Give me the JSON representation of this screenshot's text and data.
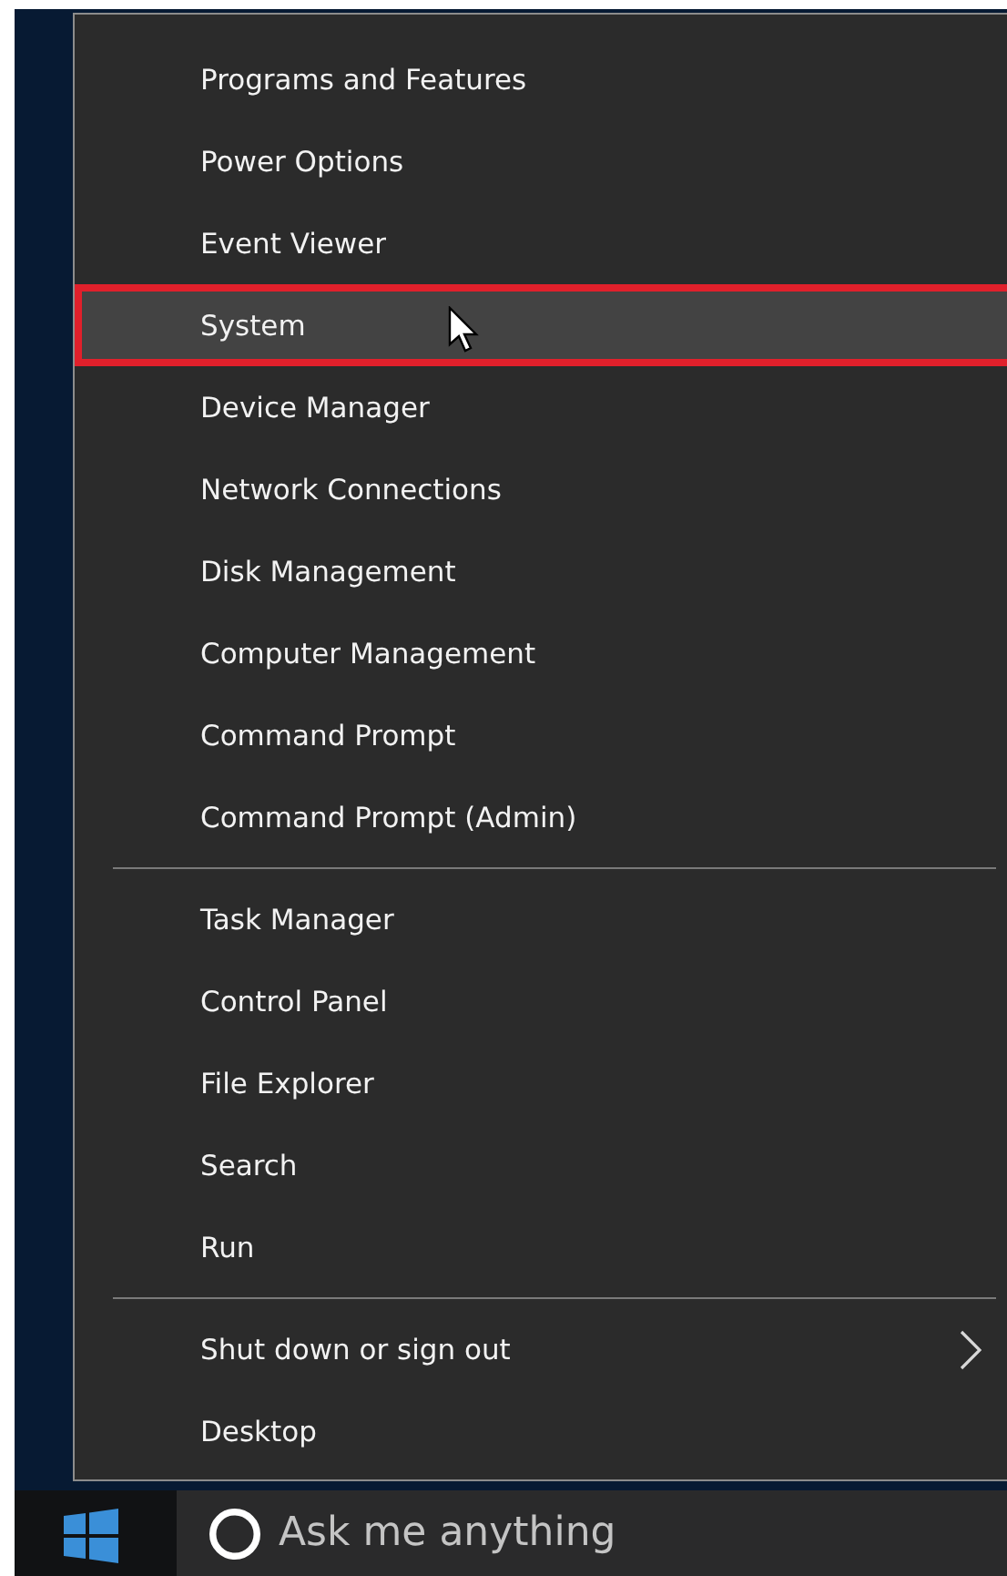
{
  "menu": {
    "groups": [
      {
        "items": [
          {
            "label": "Programs and Features",
            "selected": false,
            "submenu": false
          },
          {
            "label": "Power Options",
            "selected": false,
            "submenu": false
          },
          {
            "label": "Event Viewer",
            "selected": false,
            "submenu": false
          },
          {
            "label": "System",
            "selected": true,
            "submenu": false
          },
          {
            "label": "Device Manager",
            "selected": false,
            "submenu": false
          },
          {
            "label": "Network Connections",
            "selected": false,
            "submenu": false
          },
          {
            "label": "Disk Management",
            "selected": false,
            "submenu": false
          },
          {
            "label": "Computer Management",
            "selected": false,
            "submenu": false
          },
          {
            "label": "Command Prompt",
            "selected": false,
            "submenu": false
          },
          {
            "label": "Command Prompt (Admin)",
            "selected": false,
            "submenu": false
          }
        ]
      },
      {
        "items": [
          {
            "label": "Task Manager",
            "selected": false,
            "submenu": false
          },
          {
            "label": "Control Panel",
            "selected": false,
            "submenu": false
          },
          {
            "label": "File Explorer",
            "selected": false,
            "submenu": false
          },
          {
            "label": "Search",
            "selected": false,
            "submenu": false
          },
          {
            "label": "Run",
            "selected": false,
            "submenu": false
          }
        ]
      },
      {
        "items": [
          {
            "label": "Shut down or sign out",
            "selected": false,
            "submenu": true
          },
          {
            "label": "Desktop",
            "selected": false,
            "submenu": false
          }
        ]
      }
    ]
  },
  "taskbar": {
    "search": {
      "placeholder": "Ask me anything"
    }
  }
}
